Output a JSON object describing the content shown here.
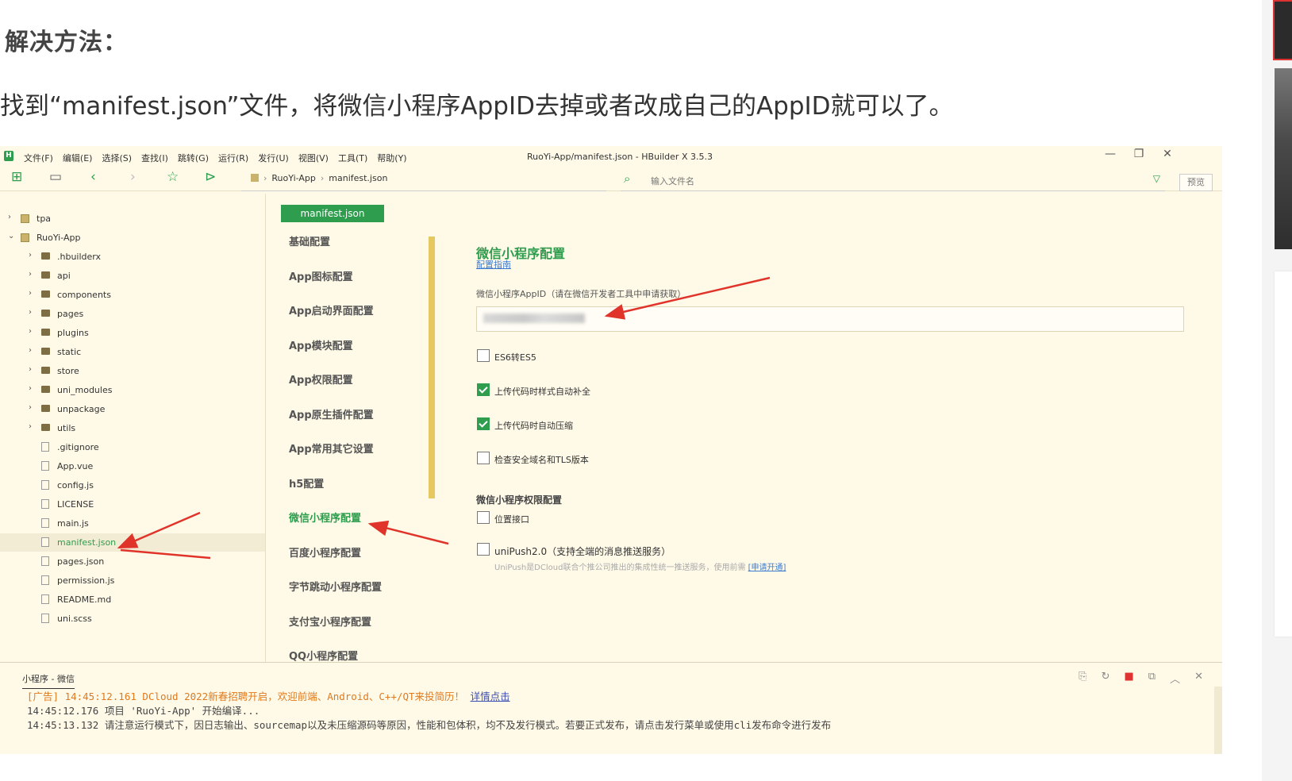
{
  "article": {
    "heading": "解决方法：",
    "text": "找到“manifest.json”文件，将微信小程序AppID去掉或者改成自己的AppID就可以了。"
  },
  "ide": {
    "window_title": "RuoYi-App/manifest.json - HBuilder X 3.5.3",
    "menus": [
      "文件(F)",
      "编辑(E)",
      "选择(S)",
      "查找(I)",
      "跳转(G)",
      "运行(R)",
      "发行(U)",
      "视图(V)",
      "工具(T)",
      "帮助(Y)"
    ],
    "breadcrumb": {
      "project": "RuoYi-App",
      "file": "manifest.json"
    },
    "search_placeholder": "输入文件名",
    "preview_label": "预览",
    "file_tree": [
      {
        "label": "tpa",
        "type": "project",
        "chevron": "right"
      },
      {
        "label": "RuoYi-App",
        "type": "project",
        "chevron": "down"
      },
      {
        "label": ".hbuilderx",
        "type": "folder",
        "chevron": "right"
      },
      {
        "label": "api",
        "type": "folder",
        "chevron": "right"
      },
      {
        "label": "components",
        "type": "folder",
        "chevron": "right"
      },
      {
        "label": "pages",
        "type": "folder",
        "chevron": "right"
      },
      {
        "label": "plugins",
        "type": "folder",
        "chevron": "right"
      },
      {
        "label": "static",
        "type": "folder",
        "chevron": "right"
      },
      {
        "label": "store",
        "type": "folder",
        "chevron": "right"
      },
      {
        "label": "uni_modules",
        "type": "folder",
        "chevron": "right"
      },
      {
        "label": "unpackage",
        "type": "folder",
        "chevron": "right"
      },
      {
        "label": "utils",
        "type": "folder",
        "chevron": "right"
      },
      {
        "label": ".gitignore",
        "type": "file",
        "chevron": ""
      },
      {
        "label": "App.vue",
        "type": "file",
        "chevron": ""
      },
      {
        "label": "config.js",
        "type": "file",
        "chevron": ""
      },
      {
        "label": "LICENSE",
        "type": "file",
        "chevron": ""
      },
      {
        "label": "main.js",
        "type": "file",
        "chevron": ""
      },
      {
        "label": "manifest.json",
        "type": "file",
        "chevron": "",
        "selected": true
      },
      {
        "label": "pages.json",
        "type": "file",
        "chevron": ""
      },
      {
        "label": "permission.js",
        "type": "file",
        "chevron": ""
      },
      {
        "label": "README.md",
        "type": "file",
        "chevron": ""
      },
      {
        "label": "uni.scss",
        "type": "file",
        "chevron": ""
      }
    ],
    "config_tab": "manifest.json",
    "config_nav": [
      "基础配置",
      "App图标配置",
      "App启动界面配置",
      "App模块配置",
      "App权限配置",
      "App原生插件配置",
      "App常用其它设置",
      "h5配置",
      "微信小程序配置",
      "百度小程序配置",
      "字节跳动小程序配置",
      "支付宝小程序配置",
      "QQ小程序配置"
    ],
    "active_nav_index": 8,
    "panel": {
      "title": "微信小程序配置",
      "guide_link": "配置指南",
      "appid_label": "微信小程序AppID（请在微信开发者工具中申请获取）",
      "options": [
        {
          "label": "ES6转ES5",
          "checked": false
        },
        {
          "label": "上传代码时样式自动补全",
          "checked": true
        },
        {
          "label": "上传代码时自动压缩",
          "checked": true
        },
        {
          "label": "检查安全域名和TLS版本",
          "checked": false
        }
      ],
      "permission_section": "微信小程序权限配置",
      "location_label": "位置接口",
      "unipush_label": "uniPush2.0（支持全端的消息推送服务）",
      "unipush_note": "UniPush是DCloud联合个推公司推出的集成性统一推送服务，使用前需",
      "unipush_link": "[申请开通]"
    },
    "console": {
      "tab": "小程序 - 微信",
      "ad_line": "[广告] 14:45:12.161 DCloud 2022新春招聘开启，欢迎前端、Android、C++/QT来投简历！",
      "ad_link": "详情点击",
      "line2": "14:45:12.176 项目 'RuoYi-App' 开始编译...",
      "line3": "14:45:13.132 请注意运行模式下，因日志输出、sourcemap以及未压缩源码等原因，性能和包体积，均不及发行模式。若要正式发布，请点击发行菜单或使用cli发布命令进行发布"
    }
  },
  "colors": {
    "accent": "#2e9d4d",
    "ide_bg": "#fffae8",
    "arrow": "#e0342b",
    "link": "#3d7bd0"
  }
}
